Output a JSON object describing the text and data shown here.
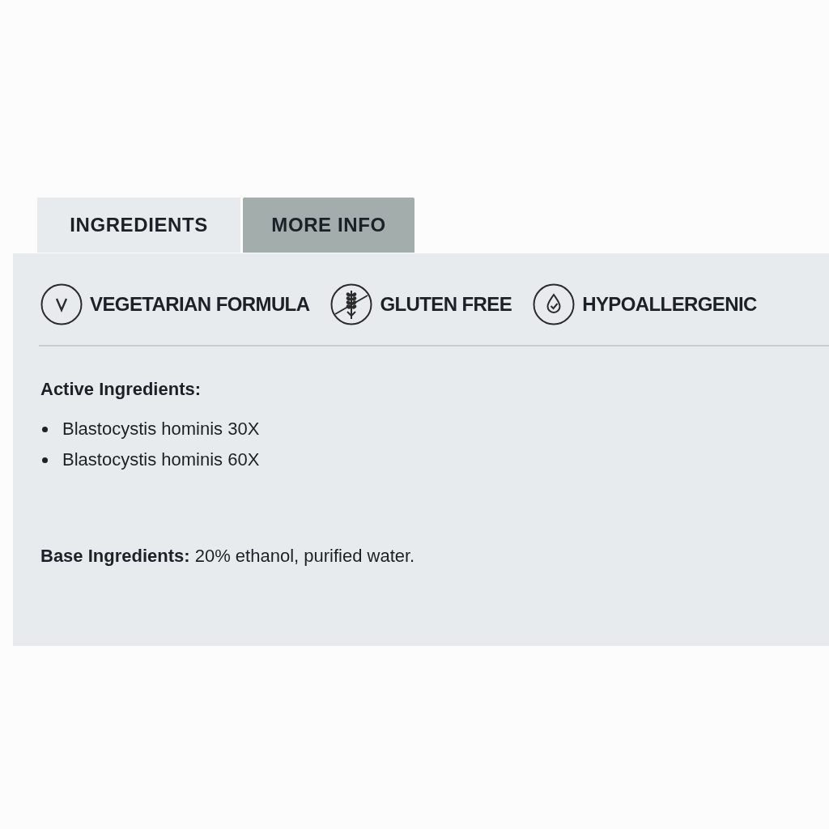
{
  "tabs": [
    {
      "label": "INGREDIENTS",
      "selected": true
    },
    {
      "label": "MORE INFO",
      "selected": false
    }
  ],
  "badges": [
    {
      "kind": "vegetarian",
      "label": "VEGETARIAN FORMULA"
    },
    {
      "kind": "gluten_free",
      "label": "GLUTEN FREE"
    },
    {
      "kind": "hypoallergenic",
      "label": "HYPOALLERGENIC"
    }
  ],
  "active_ingredients": {
    "heading": "Active Ingredients:",
    "items": [
      "Blastocystis hominis 30X",
      "Blastocystis hominis 60X"
    ]
  },
  "base_ingredients": "**Base Ingredients:** 20% ethanol, purified water."
}
